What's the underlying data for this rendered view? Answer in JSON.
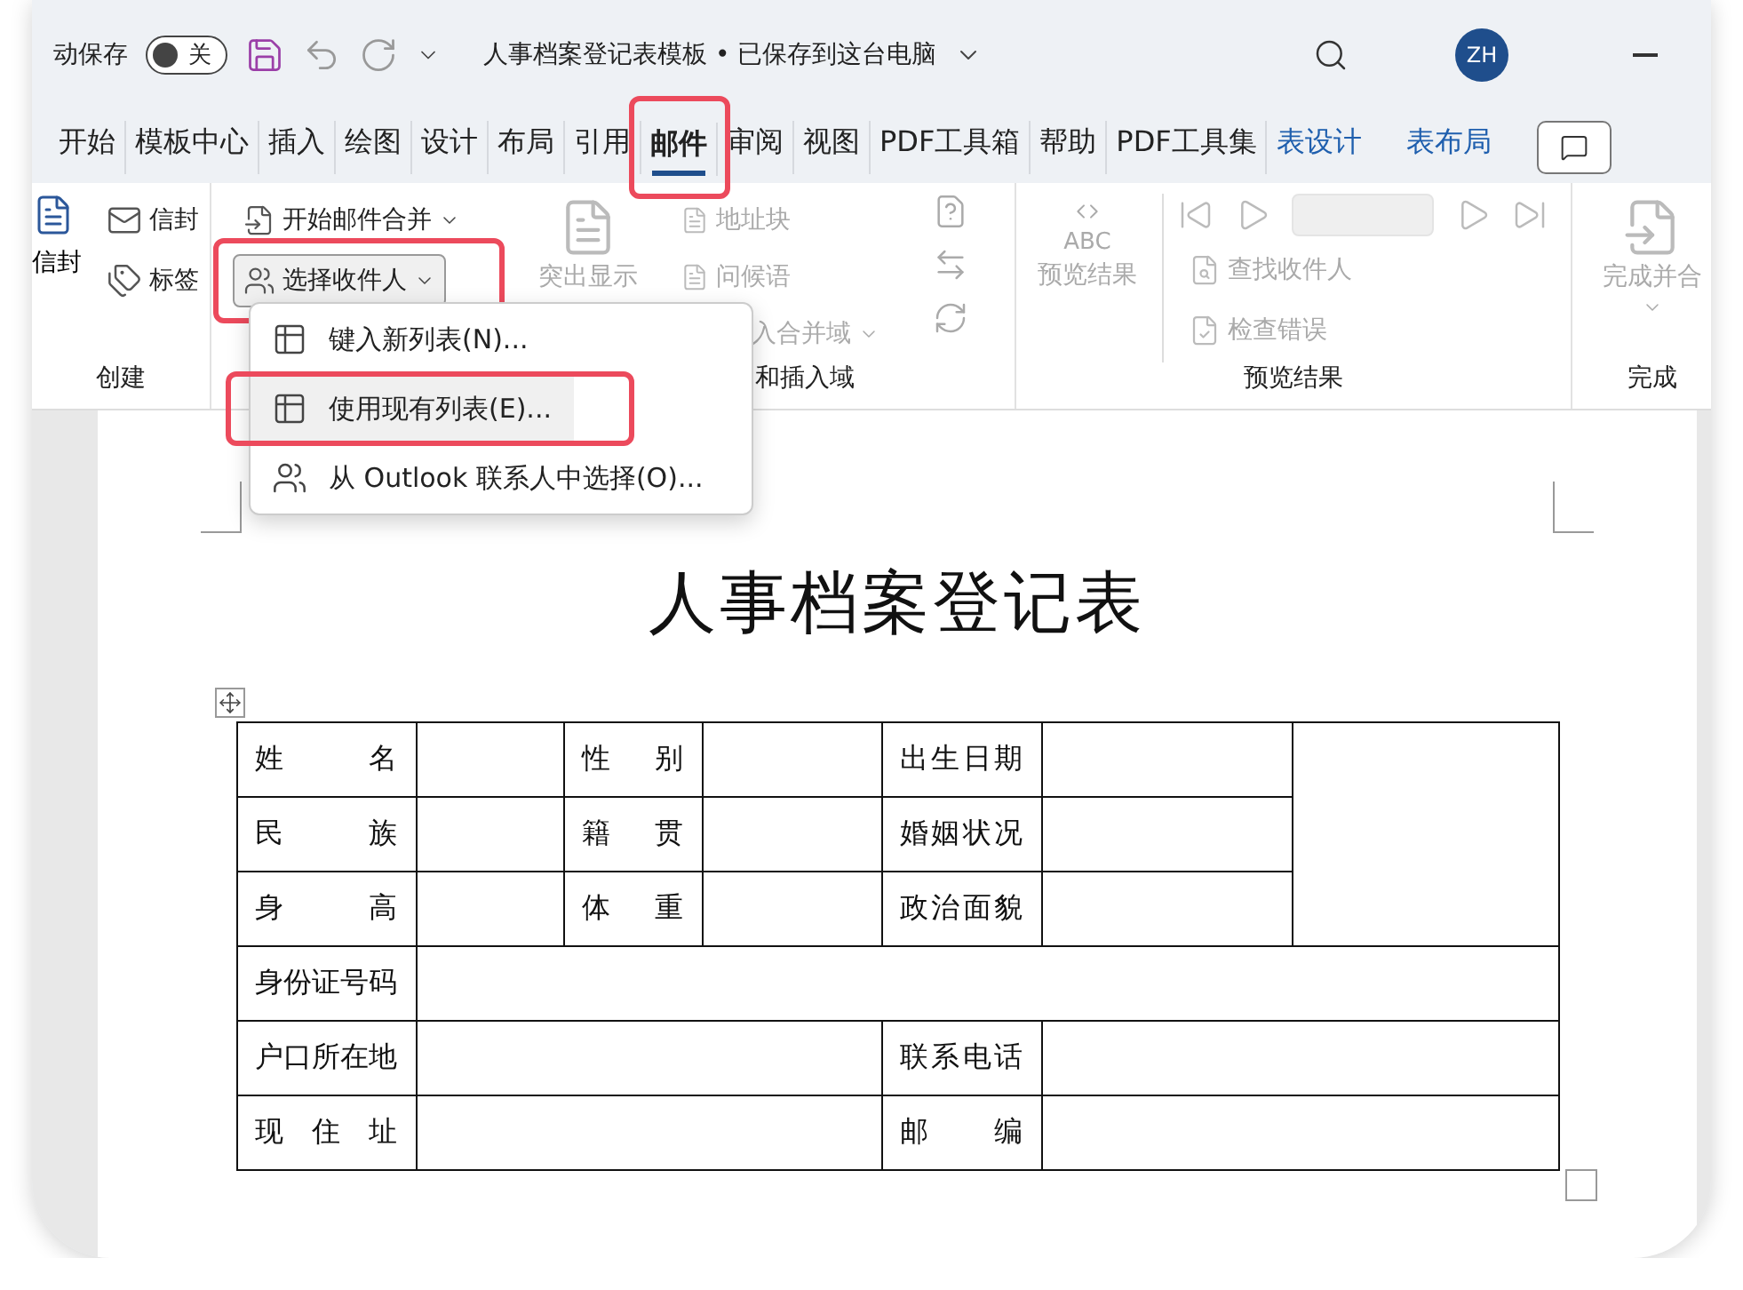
{
  "title_bar": {
    "autosave_label": "动保存",
    "autosave_toggle": {
      "label": "关",
      "on": false
    },
    "document_title": "人事档案登记表模板 • 已保存到这台电脑",
    "avatar": "ZH"
  },
  "tabs": [
    {
      "label": "开始",
      "selected": false,
      "highlighted": false,
      "kind": "standard"
    },
    {
      "label": "模板中心",
      "selected": false,
      "highlighted": false,
      "kind": "standard"
    },
    {
      "label": "插入",
      "selected": false,
      "highlighted": false,
      "kind": "standard"
    },
    {
      "label": "绘图",
      "selected": false,
      "highlighted": false,
      "kind": "standard"
    },
    {
      "label": "设计",
      "selected": false,
      "highlighted": false,
      "kind": "standard"
    },
    {
      "label": "布局",
      "selected": false,
      "highlighted": false,
      "kind": "standard"
    },
    {
      "label": "引用",
      "selected": false,
      "highlighted": false,
      "kind": "standard"
    },
    {
      "label": "邮件",
      "selected": true,
      "highlighted": true,
      "kind": "standard"
    },
    {
      "label": "审阅",
      "selected": false,
      "highlighted": false,
      "kind": "standard"
    },
    {
      "label": "视图",
      "selected": false,
      "highlighted": false,
      "kind": "standard"
    },
    {
      "label": "PDF工具箱",
      "selected": false,
      "highlighted": false,
      "kind": "standard"
    },
    {
      "label": "帮助",
      "selected": false,
      "highlighted": false,
      "kind": "standard"
    },
    {
      "label": "PDF工具集",
      "selected": false,
      "highlighted": false,
      "kind": "standard"
    },
    {
      "label": "表设计",
      "selected": false,
      "highlighted": false,
      "kind": "contextual"
    },
    {
      "label": "表布局",
      "selected": false,
      "highlighted": false,
      "kind": "contextual"
    }
  ],
  "ribbon": {
    "create": {
      "label": "创建",
      "envelope_cut": "信封",
      "envelope": {
        "label": "信封",
        "disabled": false
      },
      "labels": {
        "label": "标签",
        "disabled": false
      }
    },
    "write": {
      "label": "和插入域",
      "start_merge": {
        "label": "开始邮件合并",
        "disabled": false
      },
      "select_recipients": {
        "label": "选择收件人",
        "disabled": false,
        "highlighted": true
      },
      "highlight_fields": {
        "label": "突出显示",
        "disabled": true
      },
      "address_block": {
        "label": "地址块",
        "disabled": true
      },
      "greeting": {
        "label": "问候语",
        "disabled": true
      },
      "insert_field": {
        "label": "入合并域",
        "disabled": true
      }
    },
    "preview": {
      "label": "预览结果",
      "preview_button": {
        "label": "预览结果",
        "badge": "ABC",
        "disabled": true
      },
      "find_recipient": {
        "label": "查找收件人",
        "disabled": true
      },
      "check_errors": {
        "label": "检查错误",
        "disabled": true
      }
    },
    "finish": {
      "label": "完成",
      "finish_merge": {
        "label": "完成并合",
        "disabled": true
      }
    }
  },
  "menu": {
    "items": [
      {
        "label": "键入新列表(N)...",
        "kind": "new-list",
        "hovered": false,
        "highlighted": false
      },
      {
        "label": "使用现有列表(E)...",
        "kind": "existing-list",
        "hovered": true,
        "highlighted": true
      },
      {
        "label": "从 Outlook 联系人中选择(O)...",
        "kind": "contacts",
        "hovered": false,
        "highlighted": false
      }
    ]
  },
  "document": {
    "title": "人事档案登记表",
    "table": {
      "rows": [
        [
          {
            "kind": "label",
            "text": "姓 名"
          },
          {
            "kind": "blank"
          },
          {
            "kind": "label",
            "text": "性 别"
          },
          {
            "kind": "blank"
          },
          {
            "kind": "label",
            "text": "出生日期"
          },
          {
            "kind": "blank"
          },
          {
            "kind": "blank",
            "rowspan": 3
          }
        ],
        [
          {
            "kind": "label",
            "text": "民 族"
          },
          {
            "kind": "blank"
          },
          {
            "kind": "label",
            "text": "籍 贯"
          },
          {
            "kind": "blank"
          },
          {
            "kind": "label",
            "text": "婚姻状况"
          },
          {
            "kind": "blank"
          }
        ],
        [
          {
            "kind": "label",
            "text": "身 高"
          },
          {
            "kind": "blank"
          },
          {
            "kind": "label",
            "text": "体 重"
          },
          {
            "kind": "blank"
          },
          {
            "kind": "label",
            "text": "政治面貌"
          },
          {
            "kind": "blank"
          }
        ],
        [
          {
            "kind": "label",
            "text": "身份证号码"
          },
          {
            "kind": "blank",
            "colspan": 6
          }
        ],
        [
          {
            "kind": "label",
            "text": "户口所在地"
          },
          {
            "kind": "blank",
            "colspan": 3
          },
          {
            "kind": "label",
            "text": "联系电话"
          },
          {
            "kind": "blank",
            "colspan": 2
          }
        ],
        [
          {
            "kind": "label",
            "text": "现 住 址"
          },
          {
            "kind": "blank",
            "colspan": 3
          },
          {
            "kind": "label",
            "text": "邮 编"
          },
          {
            "kind": "blank",
            "colspan": 2
          }
        ]
      ]
    }
  }
}
